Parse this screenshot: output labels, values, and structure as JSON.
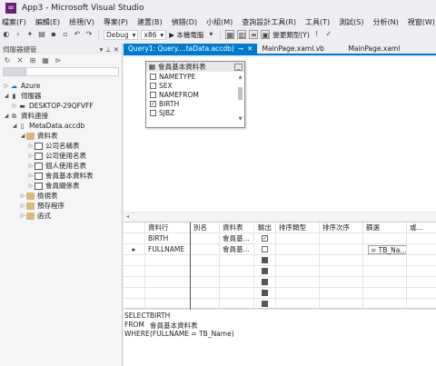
{
  "window": {
    "title": "App3 - Microsoft Visual Studio"
  },
  "menu": [
    "檔案(F)",
    "編輯(E)",
    "檢視(V)",
    "專案(P)",
    "建置(B)",
    "偵錯(D)",
    "小組(M)",
    "查詢設計工具(R)",
    "工具(T)",
    "測試(S)",
    "分析(N)",
    "視窗(W)"
  ],
  "toolbar": {
    "config": "Debug",
    "platform": "x86",
    "run_label": "▶ 本機電腦",
    "change_type": "變更類型(Y)"
  },
  "explorer": {
    "title": "伺服器總管",
    "pin": "▾ ⊥ ✕",
    "nodes": [
      {
        "label": "Azure",
        "depth": 0,
        "expanded": false,
        "icon": "cloud-icon"
      },
      {
        "label": "伺服器",
        "depth": 0,
        "expanded": true,
        "icon": "servers-icon"
      },
      {
        "label": "DESKTOP-29QFVFF",
        "depth": 1,
        "expanded": false,
        "icon": "computer-icon"
      },
      {
        "label": "資料連接",
        "depth": 0,
        "expanded": true,
        "icon": "connections-icon"
      },
      {
        "label": "MetaData.accdb",
        "depth": 1,
        "expanded": true,
        "icon": "database-icon"
      },
      {
        "label": "資料表",
        "depth": 2,
        "expanded": true,
        "icon": "folder-icon"
      },
      {
        "label": "公司名稱表",
        "depth": 3,
        "expanded": false,
        "icon": "table-icon"
      },
      {
        "label": "公司使用名表",
        "depth": 3,
        "expanded": false,
        "icon": "table-icon"
      },
      {
        "label": "個人使用名表",
        "depth": 3,
        "expanded": false,
        "icon": "table-icon"
      },
      {
        "label": "會員基本資料表",
        "depth": 3,
        "expanded": false,
        "icon": "table-icon"
      },
      {
        "label": "會員關係表",
        "depth": 3,
        "expanded": false,
        "icon": "table-icon"
      },
      {
        "label": "檢視表",
        "depth": 2,
        "expanded": false,
        "icon": "folder-icon"
      },
      {
        "label": "預存程序",
        "depth": 2,
        "expanded": false,
        "icon": "folder-icon"
      },
      {
        "label": "函式",
        "depth": 2,
        "expanded": false,
        "icon": "folder-icon"
      }
    ]
  },
  "tabs": [
    {
      "label": "Query1: Query....taData.accdb)",
      "active": true
    },
    {
      "label": "MainPage.xaml.vb",
      "active": false
    },
    {
      "label": "MainPage.xaml",
      "active": false
    }
  ],
  "table_box": {
    "title": "會員基本資料表",
    "columns": [
      {
        "name": "NAMETYPE",
        "checked": false
      },
      {
        "name": "SEX",
        "checked": false
      },
      {
        "name": "NAMEFROM",
        "checked": false
      },
      {
        "name": "BIRTH",
        "checked": true
      },
      {
        "name": "SJBZ",
        "checked": false
      }
    ]
  },
  "grid": {
    "headers": [
      "",
      "資料行",
      "別名",
      "資料表",
      "輸出",
      "排序類型",
      "排序次序",
      "篩選",
      "或..."
    ],
    "rows": [
      {
        "marker": "",
        "column": "BIRTH",
        "alias": "",
        "table": "會員基...",
        "output": "checked",
        "sort_type": "",
        "sort_order": "",
        "filter": "",
        "or": ""
      },
      {
        "marker": "▸",
        "column": "FULLNAME",
        "alias": "",
        "table": "會員基...",
        "output": "unchecked",
        "sort_type": "",
        "sort_order": "",
        "filter": "= TB_Na...",
        "or": ""
      },
      {
        "marker": "",
        "column": "",
        "alias": "",
        "table": "",
        "output": "filled",
        "sort_type": "",
        "sort_order": "",
        "filter": "",
        "or": ""
      },
      {
        "marker": "",
        "column": "",
        "alias": "",
        "table": "",
        "output": "filled",
        "sort_type": "",
        "sort_order": "",
        "filter": "",
        "or": ""
      },
      {
        "marker": "",
        "column": "",
        "alias": "",
        "table": "",
        "output": "filled",
        "sort_type": "",
        "sort_order": "",
        "filter": "",
        "or": ""
      },
      {
        "marker": "",
        "column": "",
        "alias": "",
        "table": "",
        "output": "filled",
        "sort_type": "",
        "sort_order": "",
        "filter": "",
        "or": ""
      },
      {
        "marker": "",
        "column": "",
        "alias": "",
        "table": "",
        "output": "filled",
        "sort_type": "",
        "sort_order": "",
        "filter": "",
        "or": ""
      }
    ]
  },
  "sql": [
    {
      "keyword": "SELECT",
      "text": "BIRTH"
    },
    {
      "keyword": "FROM",
      "text": "會員基本資料表"
    },
    {
      "keyword": "WHERE",
      "text": "(FULLNAME = TB_Name)"
    }
  ]
}
